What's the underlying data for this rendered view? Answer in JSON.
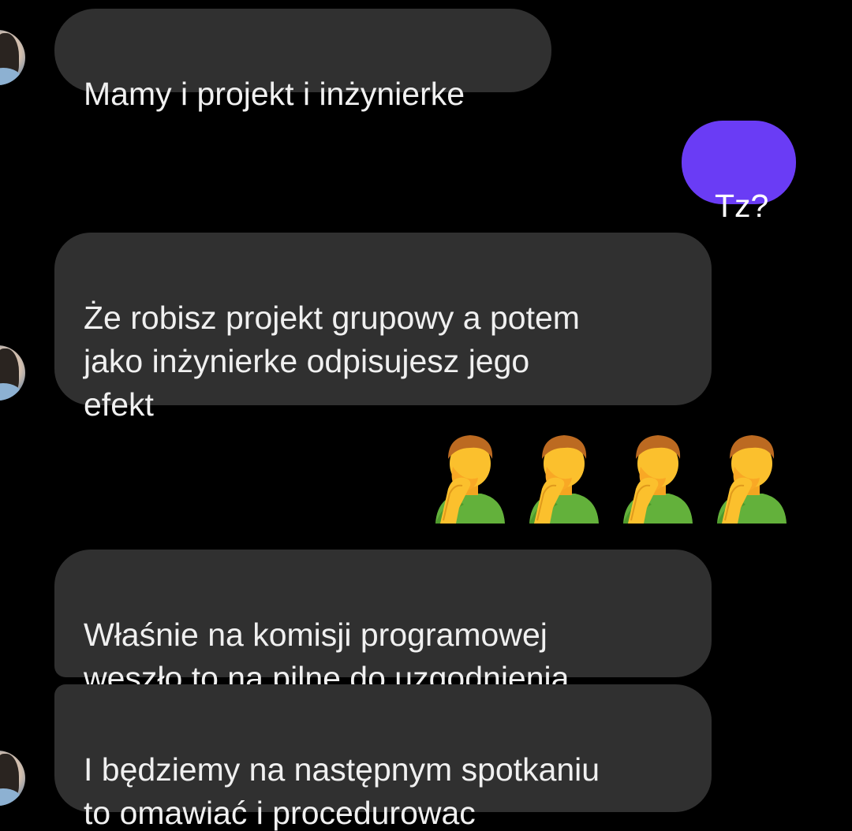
{
  "messages": [
    {
      "direction": "received",
      "text": "Mamy i projekt i inżynierke"
    },
    {
      "direction": "sent",
      "text": "Tz?"
    },
    {
      "direction": "received",
      "text": "Że robisz projekt grupowy a potem\njako inżynierke odpisujesz jego\nefekt"
    },
    {
      "direction": "sent",
      "emoji": "man-facepalming",
      "count": 4
    },
    {
      "direction": "received",
      "text": "Właśnie na komisji programowej\nweszło to na pilne do uzgodnienia"
    },
    {
      "direction": "received",
      "text": "I będziemy na następnym spotkaniu\nto omawiać i procedurowac"
    }
  ],
  "colors": {
    "background": "#000000",
    "received_bubble": "#303030",
    "sent_bubble": "#6a3cf5",
    "text": "#f0f0f0"
  }
}
